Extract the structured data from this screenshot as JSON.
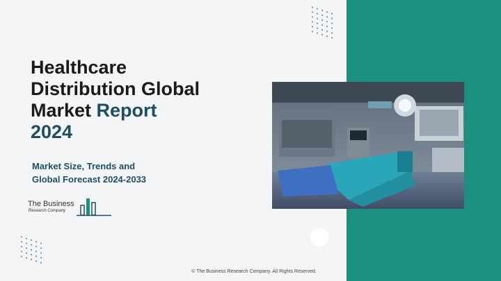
{
  "title": {
    "line1": "Healthcare",
    "line2": "Distribution Global",
    "line3_a": "Market ",
    "line3_b": "Report",
    "line4": "2024"
  },
  "subtitle": {
    "line1": "Market Size, Trends and",
    "line2": "Global Forecast 2024-2033"
  },
  "logo": {
    "line1": "The Business",
    "line2": "Research Company"
  },
  "footer": {
    "copyright": "© The Business Research Company. All Rights Reserved."
  },
  "colors": {
    "teal_panel": "#1c9080",
    "title_accent": "#1e4e63",
    "background": "#f4f5f6"
  },
  "image": {
    "subject": "operating-room-photo"
  }
}
